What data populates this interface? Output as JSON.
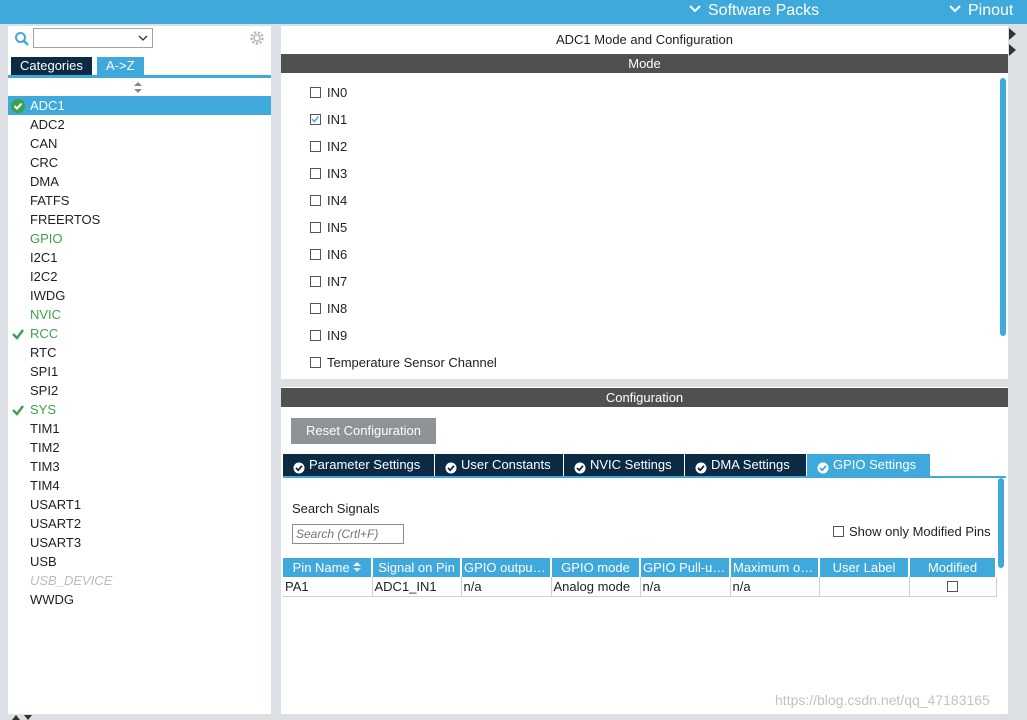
{
  "topbar": {
    "software_packs": "Software Packs",
    "pinout": "Pinout"
  },
  "left": {
    "tabs": {
      "categories": "Categories",
      "az": "A->Z"
    },
    "items": [
      {
        "label": "ADC1",
        "state": "selected"
      },
      {
        "label": "ADC2",
        "state": "normal"
      },
      {
        "label": "CAN",
        "state": "normal"
      },
      {
        "label": "CRC",
        "state": "normal"
      },
      {
        "label": "DMA",
        "state": "normal"
      },
      {
        "label": "FATFS",
        "state": "normal"
      },
      {
        "label": "FREERTOS",
        "state": "normal"
      },
      {
        "label": "GPIO",
        "state": "warn"
      },
      {
        "label": "I2C1",
        "state": "normal"
      },
      {
        "label": "I2C2",
        "state": "normal"
      },
      {
        "label": "IWDG",
        "state": "normal"
      },
      {
        "label": "NVIC",
        "state": "warn"
      },
      {
        "label": "RCC",
        "state": "configured"
      },
      {
        "label": "RTC",
        "state": "normal"
      },
      {
        "label": "SPI1",
        "state": "normal"
      },
      {
        "label": "SPI2",
        "state": "normal"
      },
      {
        "label": "SYS",
        "state": "configured"
      },
      {
        "label": "TIM1",
        "state": "normal"
      },
      {
        "label": "TIM2",
        "state": "normal"
      },
      {
        "label": "TIM3",
        "state": "normal"
      },
      {
        "label": "TIM4",
        "state": "normal"
      },
      {
        "label": "USART1",
        "state": "normal"
      },
      {
        "label": "USART2",
        "state": "normal"
      },
      {
        "label": "USART3",
        "state": "normal"
      },
      {
        "label": "USB",
        "state": "normal"
      },
      {
        "label": "USB_DEVICE",
        "state": "disabled"
      },
      {
        "label": "WWDG",
        "state": "normal"
      }
    ]
  },
  "main": {
    "title": "ADC1 Mode and Configuration",
    "mode_header": "Mode",
    "mode_items": [
      {
        "label": "IN0",
        "checked": false
      },
      {
        "label": "IN1",
        "checked": true
      },
      {
        "label": "IN2",
        "checked": false
      },
      {
        "label": "IN3",
        "checked": false
      },
      {
        "label": "IN4",
        "checked": false
      },
      {
        "label": "IN5",
        "checked": false
      },
      {
        "label": "IN6",
        "checked": false
      },
      {
        "label": "IN7",
        "checked": false
      },
      {
        "label": "IN8",
        "checked": false
      },
      {
        "label": "IN9",
        "checked": false
      },
      {
        "label": "Temperature Sensor Channel",
        "checked": false
      }
    ],
    "config_header": "Configuration",
    "reset_label": "Reset Configuration",
    "tabs": [
      {
        "label": "Parameter Settings",
        "active": false
      },
      {
        "label": "User Constants",
        "active": false
      },
      {
        "label": "NVIC Settings",
        "active": false
      },
      {
        "label": "DMA Settings",
        "active": false
      },
      {
        "label": "GPIO Settings",
        "active": true
      }
    ],
    "search_label": "Search Signals",
    "search_placeholder": "Search (Crtl+F)",
    "show_modified_label": "Show only Modified Pins",
    "table": {
      "headers": [
        "Pin Name",
        "Signal on Pin",
        "GPIO output ...",
        "GPIO mode",
        "GPIO Pull-up...",
        "Maximum ou...",
        "User Label",
        "Modified"
      ],
      "rows": [
        [
          "PA1",
          "ADC1_IN1",
          "n/a",
          "Analog mode",
          "n/a",
          "n/a",
          "",
          ""
        ]
      ]
    }
  },
  "watermark": "https://blog.csdn.net/qq_47183165",
  "colors": {
    "accent": "#3fa9dc",
    "dark_tab": "#0b2a44",
    "bar": "#505050",
    "ok_green": "#3fa04b"
  }
}
